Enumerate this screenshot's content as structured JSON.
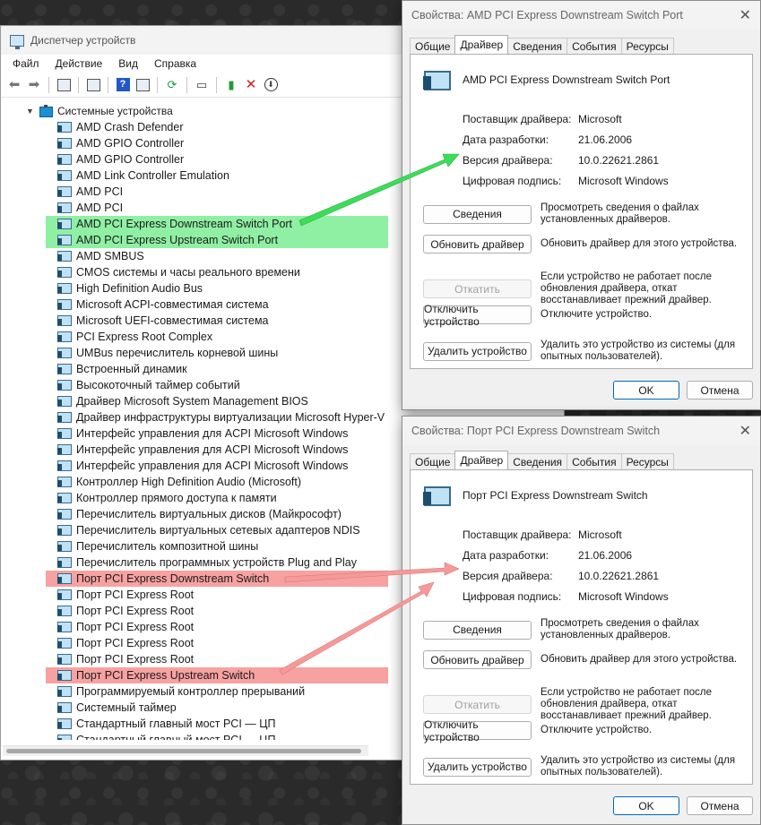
{
  "device_manager": {
    "title": "Диспетчер устройств",
    "menu": [
      "Файл",
      "Действие",
      "Вид",
      "Справка"
    ],
    "toolbar_icons": [
      "back-arrow-icon",
      "forward-arrow-icon",
      "properties-icon",
      "list-icon",
      "help-icon",
      "view-icon",
      "update-driver-icon",
      "monitor-icon",
      "enable-device-icon",
      "remove-device-icon",
      "download-icon"
    ],
    "category": "Системные устройства",
    "devices": [
      {
        "label": "AMD Crash Defender",
        "highlight": ""
      },
      {
        "label": "AMD GPIO Controller",
        "highlight": ""
      },
      {
        "label": "AMD GPIO Controller",
        "highlight": ""
      },
      {
        "label": "AMD Link Controller Emulation",
        "highlight": ""
      },
      {
        "label": "AMD PCI",
        "highlight": ""
      },
      {
        "label": "AMD PCI",
        "highlight": ""
      },
      {
        "label": "AMD PCI Express Downstream Switch Port",
        "highlight": "green"
      },
      {
        "label": "AMD PCI Express Upstream Switch Port",
        "highlight": "green"
      },
      {
        "label": "AMD SMBUS",
        "highlight": ""
      },
      {
        "label": "CMOS системы и часы реального времени",
        "highlight": ""
      },
      {
        "label": "High Definition Audio Bus",
        "highlight": ""
      },
      {
        "label": "Microsoft ACPI-совместимая система",
        "highlight": ""
      },
      {
        "label": "Microsoft UEFI-совместимая система",
        "highlight": ""
      },
      {
        "label": "PCI Express Root Complex",
        "highlight": ""
      },
      {
        "label": "UMBus перечислитель корневой шины",
        "highlight": ""
      },
      {
        "label": "Встроенный динамик",
        "highlight": ""
      },
      {
        "label": "Высокоточный таймер событий",
        "highlight": ""
      },
      {
        "label": "Драйвер Microsoft System Management BIOS",
        "highlight": ""
      },
      {
        "label": "Драйвер инфраструктуры виртуализации Microsoft Hyper-V",
        "highlight": ""
      },
      {
        "label": "Интерфейс управления для ACPI Microsoft Windows",
        "highlight": ""
      },
      {
        "label": "Интерфейс управления для ACPI Microsoft Windows",
        "highlight": ""
      },
      {
        "label": "Интерфейс управления для ACPI Microsoft Windows",
        "highlight": ""
      },
      {
        "label": "Контроллер High Definition Audio (Microsoft)",
        "highlight": ""
      },
      {
        "label": "Контроллер прямого доступа к памяти",
        "highlight": ""
      },
      {
        "label": "Перечислитель виртуальных дисков (Майкрософт)",
        "highlight": ""
      },
      {
        "label": "Перечислитель виртуальных сетевых адаптеров NDIS",
        "highlight": ""
      },
      {
        "label": "Перечислитель композитной шины",
        "highlight": ""
      },
      {
        "label": "Перечислитель программных устройств Plug and Play",
        "highlight": ""
      },
      {
        "label": "Порт PCI Express Downstream Switch",
        "highlight": "red"
      },
      {
        "label": "Порт PCI Express Root",
        "highlight": ""
      },
      {
        "label": "Порт PCI Express Root",
        "highlight": ""
      },
      {
        "label": "Порт PCI Express Root",
        "highlight": ""
      },
      {
        "label": "Порт PCI Express Root",
        "highlight": ""
      },
      {
        "label": "Порт PCI Express Root",
        "highlight": ""
      },
      {
        "label": "Порт PCI Express Upstream Switch",
        "highlight": "red"
      },
      {
        "label": "Программируемый контроллер прерываний",
        "highlight": ""
      },
      {
        "label": "Системный таймер",
        "highlight": ""
      },
      {
        "label": "Стандартный главный мост PCI — ЦП",
        "highlight": ""
      },
      {
        "label": "Стандартный главный мост PCI — ЦП",
        "highlight": ""
      }
    ]
  },
  "dialogs": [
    {
      "title": "Свойства: AMD PCI Express Downstream Switch Port",
      "tabs": [
        "Общие",
        "Драйвер",
        "Сведения",
        "События",
        "Ресурсы"
      ],
      "active_tab": 1,
      "device_name": "AMD PCI Express Downstream Switch Port",
      "props": [
        {
          "label": "Поставщик драйвера:",
          "value": "Microsoft"
        },
        {
          "label": "Дата разработки:",
          "value": "21.06.2006"
        },
        {
          "label": "Версия драйвера:",
          "value": "10.0.22621.2861"
        },
        {
          "label": "Цифровая подпись:",
          "value": "Microsoft Windows"
        }
      ]
    },
    {
      "title": "Свойства: Порт PCI Express Downstream Switch",
      "tabs": [
        "Общие",
        "Драйвер",
        "Сведения",
        "События",
        "Ресурсы"
      ],
      "active_tab": 1,
      "device_name": "Порт PCI Express Downstream Switch",
      "props": [
        {
          "label": "Поставщик драйвера:",
          "value": "Microsoft"
        },
        {
          "label": "Дата разработки:",
          "value": "21.06.2006"
        },
        {
          "label": "Версия драйвера:",
          "value": "10.0.22621.2861"
        },
        {
          "label": "Цифровая подпись:",
          "value": "Microsoft Windows"
        }
      ]
    }
  ],
  "driver_actions": [
    {
      "button": "Сведения",
      "description": "Просмотреть сведения о файлах установленных драйверов.",
      "disabled": false
    },
    {
      "button": "Обновить драйвер",
      "description": "Обновить драйвер для этого устройства.",
      "disabled": false
    },
    {
      "button": "Откатить",
      "description": "Если устройство не работает после обновления драйвера, откат восстанавливает прежний драйвер.",
      "disabled": true
    },
    {
      "button": "Отключить устройство",
      "description": "Отключите устройство.",
      "disabled": false
    },
    {
      "button": "Удалить устройство",
      "description": "Удалить это устройство из системы (для опытных пользователей).",
      "disabled": false
    }
  ],
  "footer": {
    "ok": "OK",
    "cancel": "Отмена"
  },
  "colors": {
    "highlight_green": "#8ff0a4",
    "highlight_red": "#f7a1a1",
    "arrow_green": "#3ddc5a",
    "arrow_red": "#f59a9a"
  }
}
